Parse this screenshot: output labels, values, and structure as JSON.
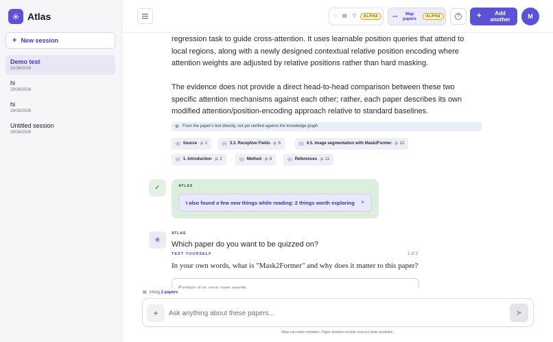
{
  "app": {
    "name": "Atlas",
    "logo_icon": "asterisk-logo"
  },
  "sidebar": {
    "new_session_label": "New session",
    "sessions": [
      {
        "title": "Demo test",
        "date": "31/08/2026",
        "active": true
      },
      {
        "title": "hi",
        "date": "29/08/2026",
        "active": false
      },
      {
        "title": "hi",
        "date": "29/08/2026",
        "active": false
      },
      {
        "title": "Untitled session",
        "date": "28/08/2026",
        "active": false
      }
    ]
  },
  "topbar": {
    "tools_badge": "ALPHA",
    "map_papers_label": "Map papers",
    "map_badge": "ALPHA",
    "help_glyph": "?",
    "add_another_label": "Add another",
    "avatar_initial": "M"
  },
  "chat": {
    "paragraph_1": "regression task to guide cross-attention. It uses learnable position queries that attend to local regions, along with a newly designed contextual relative position encoding where attention weights are adjusted by relative positions rather than hard masking.",
    "paragraph_2": "The evidence does not provide a direct head-to-head comparison between these two specific attention mechanisms against each other; rather, each paper describes its own modified attention/position-encoding approach relative to standard baselines.",
    "source_note": "From the paper's text directly, not yet verified against the knowledge graph",
    "citations": [
      {
        "label": "Source",
        "page": "· p. 1"
      },
      {
        "label": "3.3. Receptive Fields",
        "page": "· p. 6"
      },
      {
        "label": "4.5. Image segmentation with Mask2Former",
        "page": "· p. 12"
      },
      {
        "label": "1. Introduction",
        "page": "· p. 2"
      },
      {
        "label": "Method",
        "page": "· p. 6"
      },
      {
        "label": "References",
        "page": "· p. 11"
      }
    ],
    "found_card": {
      "label": "ATLAS",
      "text": "I also found a few new things while reading: 2 things worth exploring"
    },
    "quiz": {
      "label": "ATLAS",
      "title": "Which paper do you want to be quizzed on?",
      "section_label": "TEST YOURSELF",
      "counter": "1 of 2",
      "question": "In your own words, what is \"Mask2Former\" and why does it matter to this paper?",
      "answer_placeholder": "Explain it in your own words..."
    }
  },
  "composer": {
    "using_prefix": "Using",
    "using_count": "2 papers",
    "placeholder": "Ask anything about these papers...",
    "disclaimer": "Atlas can make mistakes. Paper answers include sources when available."
  },
  "colors": {
    "accent": "#5b52d6",
    "badge": "#fdf2c6",
    "success_bg": "#dcefdd"
  }
}
